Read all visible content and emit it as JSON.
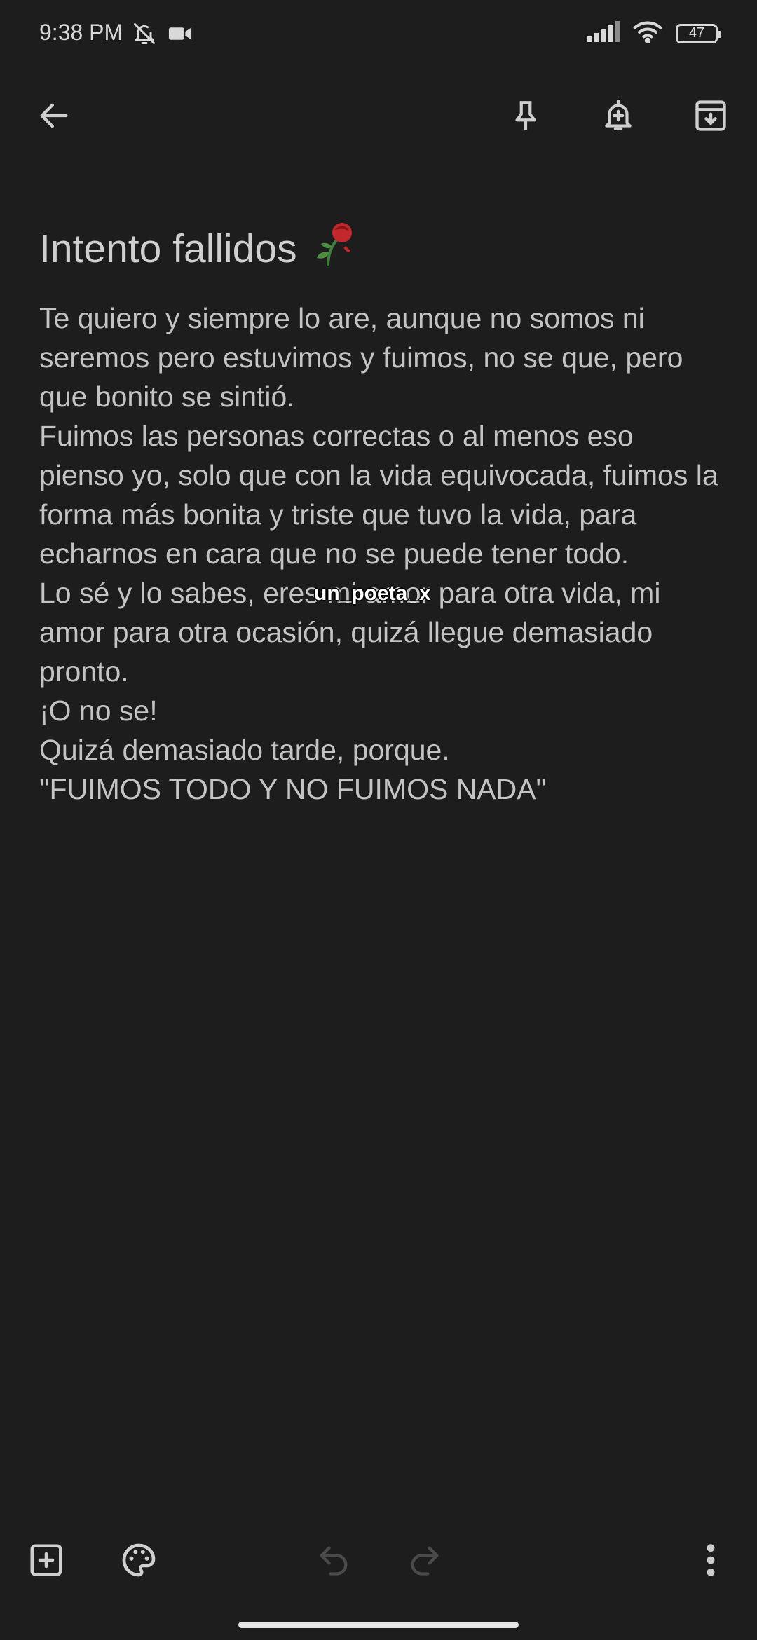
{
  "status_bar": {
    "time": "9:38 PM",
    "battery_level": "47",
    "icons": [
      "bell-off-icon",
      "video-camera-icon",
      "signal-icon",
      "wifi-icon",
      "battery-icon"
    ]
  },
  "toolbar": {
    "icons": [
      "back-arrow-icon",
      "pin-icon",
      "reminder-bell-icon",
      "archive-icon"
    ]
  },
  "note": {
    "title": "Intento fallidos",
    "title_emoji": "wilted-rose-icon",
    "body": [
      "Te quiero y siempre lo are, aunque no somos ni seremos pero estuvimos y fuimos, no se que, pero que bonito se sintió.",
      "Fuimos las personas correctas o al menos eso pienso yo, solo que con la vida equivocada, fuimos la forma más bonita y triste que tuvo la vida, para echarnos en cara que no se puede tener todo.",
      "Lo sé y lo sabes, eres mi amor para otra vida, mi amor para otra ocasión, quizá llegue demasiado pronto.",
      "¡O no se!",
      "Quizá demasiado tarde, porque.",
      "\"FUIMOS TODO Y NO FUIMOS NADA\""
    ]
  },
  "watermark": "un_poeta_x",
  "bottom_bar": {
    "icons": [
      "add-box-icon",
      "palette-icon",
      "undo-icon",
      "redo-icon",
      "more-vert-icon"
    ]
  },
  "colors": {
    "background": "#1d1d1d",
    "text": "#c3c3c3",
    "icon": "#cfcfcf",
    "disabled_icon": "#4a4a4a"
  }
}
